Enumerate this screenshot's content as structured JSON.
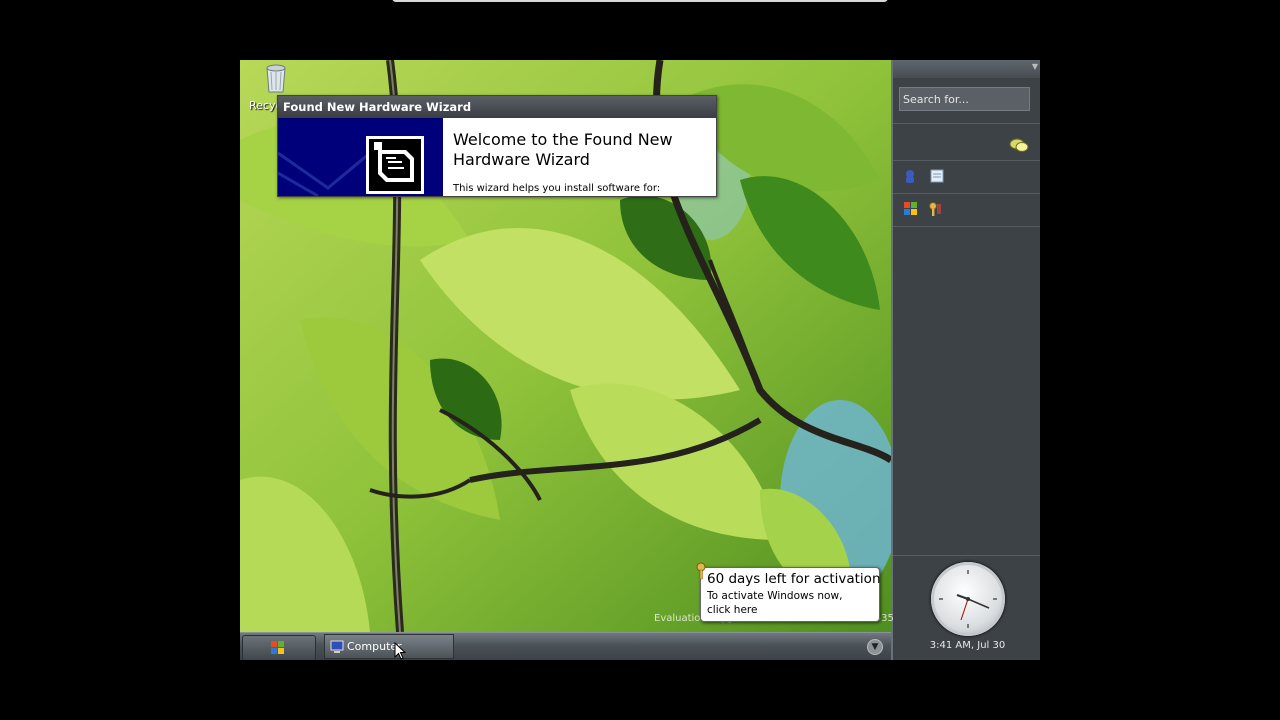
{
  "desktop": {
    "recycle_bin_label": "Recyc"
  },
  "wizard": {
    "title": "Found New Hardware Wizard",
    "heading": "Welcome to the Found New Hardware Wizard",
    "body": "This wizard helps you install software for:"
  },
  "sidebar": {
    "search_placeholder": "Search for...",
    "clock_label": "3:41 AM, Jul 30"
  },
  "taskbar": {
    "task_label": "Computer"
  },
  "balloon": {
    "title": "60 days left for activation",
    "line1": "To activate Windows now,",
    "line2": "click here"
  },
  "watermark": "Evaluation copy. Build 4074.idx02.040425-1535",
  "colors": {
    "wizard_banner": "#00007a",
    "sidebar_bg": "#3d4247",
    "taskbar_bg": "#4a5157"
  },
  "icons": [
    "recycle-bin-icon",
    "hardware-icon",
    "chat-icon",
    "windows-logo-icon",
    "key-icon",
    "monitor-icon",
    "chevron-down-icon",
    "mouse-cursor-icon"
  ]
}
